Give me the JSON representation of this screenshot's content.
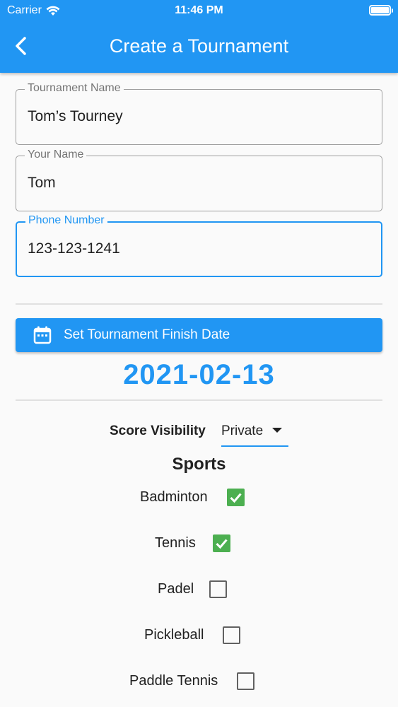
{
  "status": {
    "carrier": "Carrier",
    "time": "11:46 PM"
  },
  "appbar": {
    "title": "Create a Tournament"
  },
  "form": {
    "tournament_name": {
      "label": "Tournament Name",
      "value": "Tom’s Tourney"
    },
    "your_name": {
      "label": "Your Name",
      "value": "Tom"
    },
    "phone": {
      "label": "Phone Number",
      "value": "123-123-1241"
    }
  },
  "date_button": {
    "label": "Set Tournament Finish Date"
  },
  "finish_date": "2021-02-13",
  "score_visibility": {
    "label": "Score Visibility",
    "value": "Private"
  },
  "sports": {
    "heading": "Sports",
    "items": [
      {
        "label": "Badminton",
        "checked": true
      },
      {
        "label": "Tennis",
        "checked": true
      },
      {
        "label": "Padel",
        "checked": false
      },
      {
        "label": "Pickleball",
        "checked": false
      },
      {
        "label": "Paddle Tennis",
        "checked": false
      }
    ]
  },
  "colors": {
    "primary": "#2196f3",
    "checkbox": "#4caf50"
  }
}
